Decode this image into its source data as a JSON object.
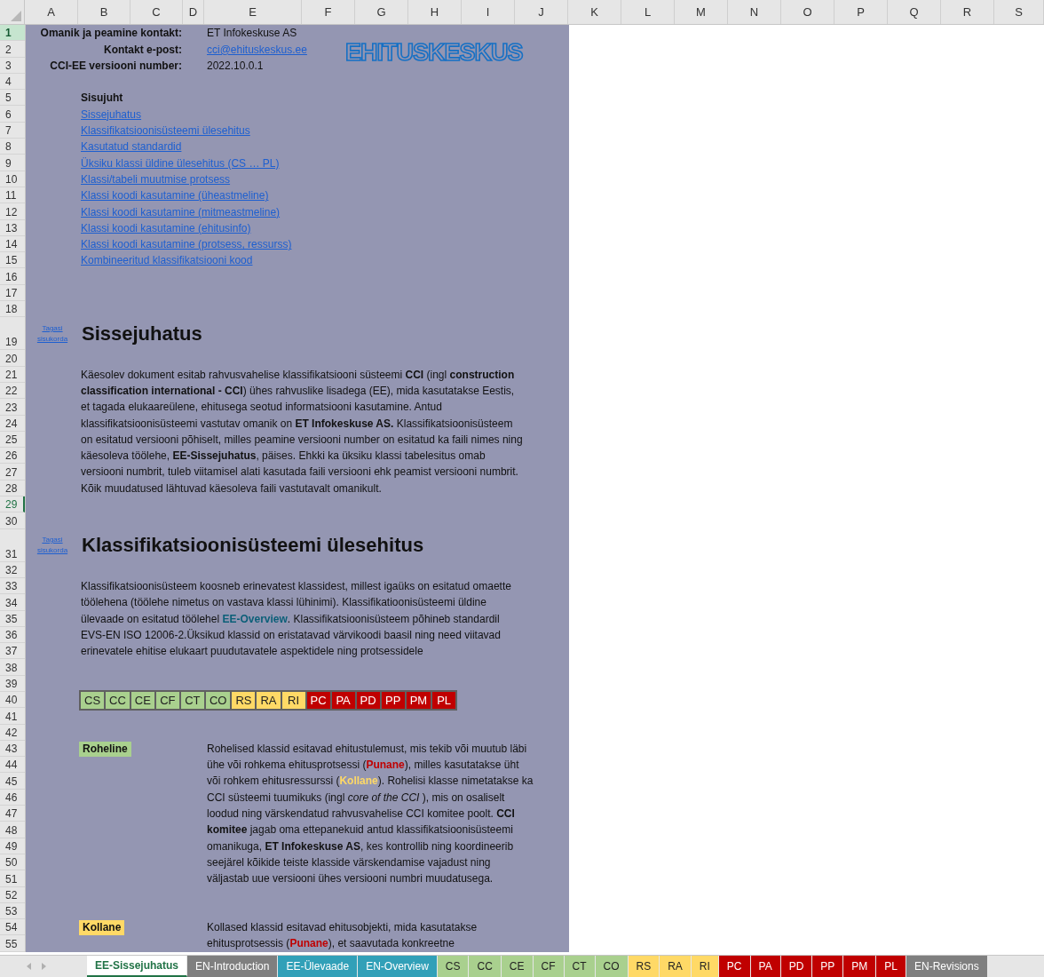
{
  "columns": [
    {
      "label": "A"
    },
    {
      "label": "B"
    },
    {
      "label": "C"
    },
    {
      "label": "D"
    },
    {
      "label": "E"
    },
    {
      "label": "F"
    },
    {
      "label": "G"
    },
    {
      "label": "H"
    },
    {
      "label": "I"
    },
    {
      "label": "J"
    },
    {
      "label": "K"
    },
    {
      "label": "L"
    },
    {
      "label": "M"
    },
    {
      "label": "N"
    },
    {
      "label": "O"
    },
    {
      "label": "P"
    },
    {
      "label": "Q"
    },
    {
      "label": "R"
    },
    {
      "label": "S"
    }
  ],
  "rows": [
    {
      "label": "1",
      "selected": true,
      "focused": false
    },
    {
      "label": "2",
      "selected": false,
      "focused": false
    },
    {
      "label": "3",
      "selected": false,
      "focused": false
    },
    {
      "label": "4",
      "selected": false,
      "focused": false
    },
    {
      "label": "5",
      "selected": false,
      "focused": false
    },
    {
      "label": "6",
      "selected": false,
      "focused": false
    },
    {
      "label": "7",
      "selected": false,
      "focused": false
    },
    {
      "label": "8",
      "selected": false,
      "focused": false
    },
    {
      "label": "9",
      "selected": false,
      "focused": false
    },
    {
      "label": "10",
      "selected": false,
      "focused": false
    },
    {
      "label": "11",
      "selected": false,
      "focused": false
    },
    {
      "label": "12",
      "selected": false,
      "focused": false
    },
    {
      "label": "13",
      "selected": false,
      "focused": false
    },
    {
      "label": "14",
      "selected": false,
      "focused": false
    },
    {
      "label": "15",
      "selected": false,
      "focused": false
    },
    {
      "label": "16",
      "selected": false,
      "focused": false
    },
    {
      "label": "17",
      "selected": false,
      "focused": false
    },
    {
      "label": "18",
      "selected": false,
      "focused": false
    },
    {
      "label": "19",
      "selected": false,
      "focused": false
    },
    {
      "label": "20",
      "selected": false,
      "focused": false
    },
    {
      "label": "21",
      "selected": false,
      "focused": false
    },
    {
      "label": "22",
      "selected": false,
      "focused": false
    },
    {
      "label": "23",
      "selected": false,
      "focused": false
    },
    {
      "label": "24",
      "selected": false,
      "focused": false
    },
    {
      "label": "25",
      "selected": false,
      "focused": false
    },
    {
      "label": "26",
      "selected": false,
      "focused": false
    },
    {
      "label": "27",
      "selected": false,
      "focused": false
    },
    {
      "label": "28",
      "selected": false,
      "focused": false
    },
    {
      "label": "29",
      "selected": false,
      "focused": true
    },
    {
      "label": "30",
      "selected": false,
      "focused": false
    },
    {
      "label": "31",
      "selected": false,
      "focused": false
    },
    {
      "label": "32",
      "selected": false,
      "focused": false
    },
    {
      "label": "33",
      "selected": false,
      "focused": false
    },
    {
      "label": "34",
      "selected": false,
      "focused": false
    },
    {
      "label": "35",
      "selected": false,
      "focused": false
    },
    {
      "label": "36",
      "selected": false,
      "focused": false
    },
    {
      "label": "37",
      "selected": false,
      "focused": false
    },
    {
      "label": "38",
      "selected": false,
      "focused": false
    },
    {
      "label": "39",
      "selected": false,
      "focused": false
    },
    {
      "label": "40",
      "selected": false,
      "focused": false
    },
    {
      "label": "41",
      "selected": false,
      "focused": false
    },
    {
      "label": "42",
      "selected": false,
      "focused": false
    },
    {
      "label": "43",
      "selected": false,
      "focused": false
    },
    {
      "label": "44",
      "selected": false,
      "focused": false
    },
    {
      "label": "45",
      "selected": false,
      "focused": false
    },
    {
      "label": "46",
      "selected": false,
      "focused": false
    },
    {
      "label": "47",
      "selected": false,
      "focused": false
    },
    {
      "label": "48",
      "selected": false,
      "focused": false
    },
    {
      "label": "49",
      "selected": false,
      "focused": false
    },
    {
      "label": "50",
      "selected": false,
      "focused": false
    },
    {
      "label": "51",
      "selected": false,
      "focused": false
    },
    {
      "label": "52",
      "selected": false,
      "focused": false
    },
    {
      "label": "53",
      "selected": false,
      "focused": false
    },
    {
      "label": "54",
      "selected": false,
      "focused": false
    },
    {
      "label": "55",
      "selected": false,
      "focused": false
    }
  ],
  "info": [
    {
      "label": "Omanik ja peamine kontakt:",
      "value": "ET Infokeskuse AS",
      "kind": "text"
    },
    {
      "label": "Kontakt e-post:",
      "value": "cci@ehituskeskus.ee",
      "kind": "link"
    },
    {
      "label": "CCI-EE versiooni number:",
      "value": "2022.10.0.1",
      "kind": "text"
    }
  ],
  "logo": "EHITUSKESKUS",
  "contents": {
    "title": "Sisujuht",
    "links": [
      "Sissejuhatus",
      "Klassifikatsioonisüsteemi ülesehitus",
      "Kasutatud standardid",
      "Üksiku klassi üldine ülesehitus (CS … PL)",
      "Klassi/tabeli muutmise protsess",
      "Klassi koodi kasutamine (üheastmeline)",
      "Klassi koodi kasutamine (mitmeastmeline)",
      "Klassi koodi kasutamine (ehitusinfo)",
      "Klassi koodi kasutamine (protsess, ressurss)",
      "Kombineeritud klassifikatsiooni kood"
    ]
  },
  "sections": [
    {
      "back_link": "Tagasi sisukorda",
      "heading": "Sissejuhatus",
      "paragraph": [
        {
          "kind": "text",
          "text": "Käesolev dokument esitab rahvusvahelise klassifikatsiooni süsteemi "
        },
        {
          "kind": "bold",
          "text": "CCI"
        },
        {
          "kind": "text",
          "text": " (ingl "
        },
        {
          "kind": "bold",
          "text": "construction classification international - CCI"
        },
        {
          "kind": "text",
          "text": ") ühes rahvuslike lisadega (EE), mida kasutatakse Eestis, et tagada elukaareülene, ehitusega seotud informatsiooni kasutamine. Antud klassifikatsioonisüsteemi vastutav omanik on "
        },
        {
          "kind": "bold",
          "text": "ET Infokeskuse AS."
        },
        {
          "kind": "text",
          "text": " Klassifikatsioonisüsteem on esitatud versiooni põhiselt, milles peamine versiooni number on esitatud ka faili nimes ning käesoleva töölehe, "
        },
        {
          "kind": "bold",
          "text": "EE-Sissejuhatus"
        },
        {
          "kind": "text",
          "text": ", päises. Ehkki ka üksiku klassi tabelesitus omab versiooni numbrit, tuleb viitamisel alati kasutada faili versiooni ehk peamist versiooni numbrit. Kõik muudatused lähtuvad käesoleva faili vastutavalt omanikult."
        }
      ]
    },
    {
      "back_link": "Tagasi sisukorda",
      "heading": "Klassifikatsioonisüsteemi ülesehitus",
      "paragraph": [
        {
          "kind": "text",
          "text": "Klassifikatsioonisüsteem koosneb erinevatest klassidest, millest igaüks on esitatud omaette töölehena (töölehe nimetus on vastava klassi lühinimi). Klassifikatioonisüsteemi üldine ülevaade on esitatud töölehel "
        },
        {
          "kind": "link",
          "text": "EE-Overview"
        },
        {
          "kind": "text",
          "text": ". Klassifikatsioonisüsteem põhineb standardil EVS-EN ISO 12006-2.Üksikud klassid on eristatavad värvikoodi baasil ning need viitavad erinevatele ehitise elukaart puudutavatele aspektidele ning protsessidele"
        }
      ]
    }
  ],
  "class_strip": [
    {
      "label": "CS",
      "color": "#a9d08e"
    },
    {
      "label": "CC",
      "color": "#a9d08e"
    },
    {
      "label": "CE",
      "color": "#a9d08e"
    },
    {
      "label": "CF",
      "color": "#a9d08e"
    },
    {
      "label": "CT",
      "color": "#a9d08e"
    },
    {
      "label": "CO",
      "color": "#a9d08e"
    },
    {
      "label": "RS",
      "color": "#ffd966"
    },
    {
      "label": "RA",
      "color": "#ffd966"
    },
    {
      "label": "RI",
      "color": "#ffd966"
    },
    {
      "label": "PC",
      "color": "#c00000"
    },
    {
      "label": "PA",
      "color": "#c00000"
    },
    {
      "label": "PD",
      "color": "#c00000"
    },
    {
      "label": "PP",
      "color": "#c00000"
    },
    {
      "label": "PM",
      "color": "#c00000"
    },
    {
      "label": "PL",
      "color": "#c00000"
    }
  ],
  "legend": [
    {
      "label": "Roheline",
      "color": "#a9d08e",
      "paragraph": [
        {
          "kind": "text",
          "text": "Rohelised klassid esitavad ehitustulemust, mis tekib või muutub läbi ühe või rohkema ehitusprotsessi ("
        },
        {
          "kind": "red",
          "text": "Punane"
        },
        {
          "kind": "text",
          "text": "), milles kasutatakse üht või rohkem ehitusressurssi ("
        },
        {
          "kind": "yellow",
          "text": "Kollane"
        },
        {
          "kind": "text",
          "text": "). Rohelisi klasse nimetatakse ka CCI süsteemi tuumikuks (ingl "
        },
        {
          "kind": "italic",
          "text": "core of the CCI"
        },
        {
          "kind": "text",
          "text": " ), mis on osaliselt loodud ning värskendatud rahvusvahelise CCI komitee poolt. "
        },
        {
          "kind": "bold",
          "text": "CCI komitee"
        },
        {
          "kind": "text",
          "text": " jagab oma ettepanekuid antud klassifikatsioonisüsteemi omanikuga, "
        },
        {
          "kind": "bold",
          "text": "ET Infokeskuse AS"
        },
        {
          "kind": "text",
          "text": ", kes kontrollib ning koordineerib seejärel kõikide teiste klasside värskendamise vajadust ning väljastab uue versiooni ühes versiooni numbri muudatusega."
        }
      ]
    },
    {
      "label": "Kollane",
      "color": "#ffd966",
      "paragraph": [
        {
          "kind": "text",
          "text": "Kollased klassid esitavad ehitusobjekti, mida kasutatakse ehitusprotsessis ("
        },
        {
          "kind": "red",
          "text": "Punane"
        },
        {
          "kind": "text",
          "text": "), et saavutada konkreetne"
        }
      ]
    }
  ],
  "sheet_tabs": [
    {
      "label": "EE-Sissejuhatus",
      "color": "#ffffff",
      "selected": true
    },
    {
      "label": "EN-Introduction",
      "color": "#7f7f7f",
      "selected": false
    },
    {
      "label": "EE-Ülevaade",
      "color": "#31a0b8",
      "selected": false
    },
    {
      "label": "EN-Overview",
      "color": "#31a0b8",
      "selected": false
    },
    {
      "label": "CS",
      "color": "#a9d08e",
      "selected": false
    },
    {
      "label": "CC",
      "color": "#a9d08e",
      "selected": false
    },
    {
      "label": "CE",
      "color": "#a9d08e",
      "selected": false
    },
    {
      "label": "CF",
      "color": "#a9d08e",
      "selected": false
    },
    {
      "label": "CT",
      "color": "#a9d08e",
      "selected": false
    },
    {
      "label": "CO",
      "color": "#a9d08e",
      "selected": false
    },
    {
      "label": "RS",
      "color": "#ffd966",
      "selected": false
    },
    {
      "label": "RA",
      "color": "#ffd966",
      "selected": false
    },
    {
      "label": "RI",
      "color": "#ffd966",
      "selected": false
    },
    {
      "label": "PC",
      "color": "#c00000",
      "selected": false
    },
    {
      "label": "PA",
      "color": "#c00000",
      "selected": false
    },
    {
      "label": "PD",
      "color": "#c00000",
      "selected": false
    },
    {
      "label": "PP",
      "color": "#c00000",
      "selected": false
    },
    {
      "label": "PM",
      "color": "#c00000",
      "selected": false
    },
    {
      "label": "PL",
      "color": "#c00000",
      "selected": false
    },
    {
      "label": "EN-Revisions",
      "color": "#7f7f7f",
      "selected": false
    }
  ]
}
